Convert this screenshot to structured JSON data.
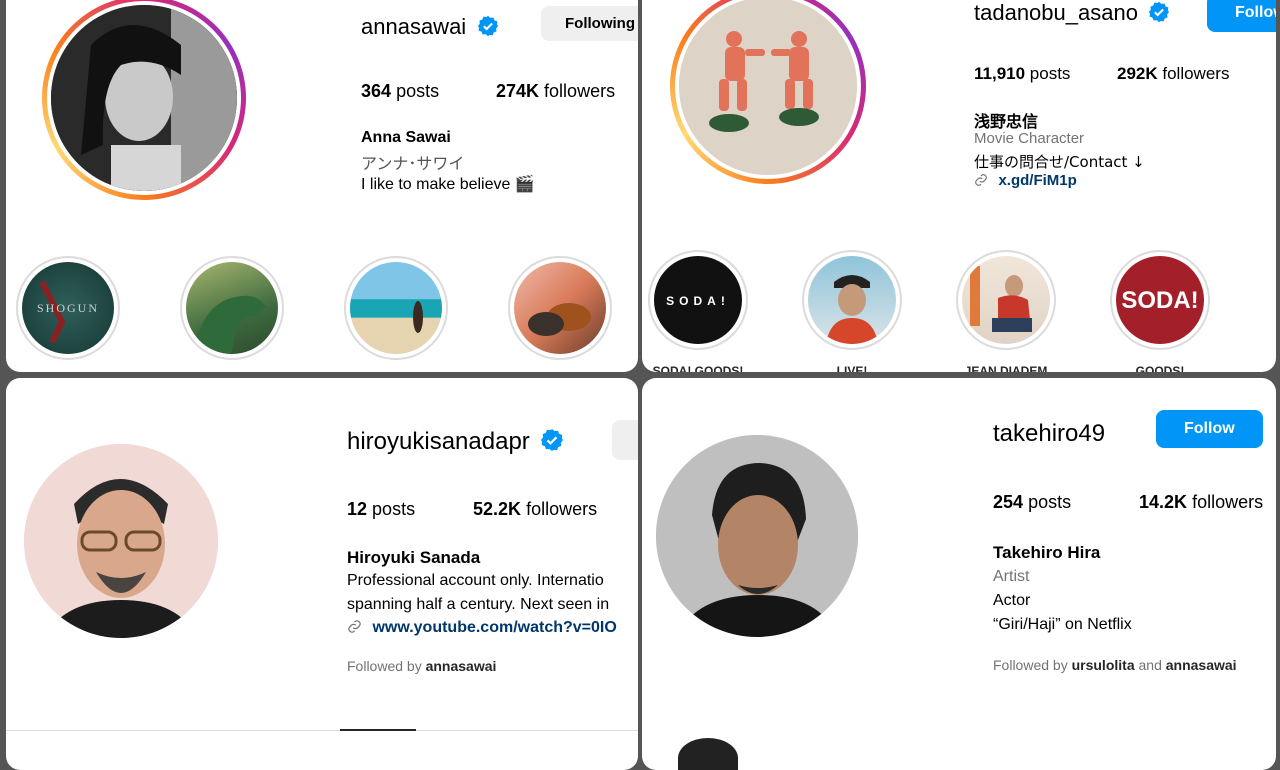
{
  "profiles": [
    {
      "username": "annasawai",
      "button": "Following",
      "posts_count": "364",
      "posts_label": "posts",
      "followers_count": "274K",
      "followers_label": "followers",
      "full_name": "Anna Sawai",
      "bio_lines": [
        "アンナ･サワイ",
        "I like to make believe 🎬"
      ],
      "highlights": [
        {
          "label": "",
          "art": "shogun"
        },
        {
          "label": "",
          "art": "godzilla"
        },
        {
          "label": "",
          "art": "beach"
        },
        {
          "label": "",
          "art": "dogs"
        }
      ]
    },
    {
      "username": "tadanobu_asano",
      "button": "Follow",
      "posts_count": "11,910",
      "posts_label": "posts",
      "followers_count": "292K",
      "followers_label": "followers",
      "full_name": "浅野忠信",
      "category": "Movie Character",
      "bio_lines": [
        "仕事の問合せ/Contact ↓"
      ],
      "link": "x.gd/FiM1p",
      "highlights": [
        {
          "label": "SODA! GOODS!",
          "art": "soda-black"
        },
        {
          "label": "LIVE!",
          "art": "man-cap"
        },
        {
          "label": "JEAN DIADEM",
          "art": "man-chair"
        },
        {
          "label": "GOODS!",
          "art": "soda-red"
        }
      ]
    },
    {
      "username": "hiroyukisanadapr",
      "posts_count": "12",
      "posts_label": "posts",
      "followers_count": "52.2K",
      "followers_label": "followers",
      "full_name": "Hiroyuki Sanada",
      "bio_lines": [
        "Professional account only. Internatio",
        "spanning half a century. Next seen in"
      ],
      "link": "www.youtube.com/watch?v=0IO",
      "followed_by_prefix": "Followed by",
      "followed_by_user1": "annasawai"
    },
    {
      "username": "takehiro49",
      "button": "Follow",
      "posts_count": "254",
      "posts_label": "posts",
      "followers_count": "14.2K",
      "followers_label": "followers",
      "full_name": "Takehiro Hira",
      "category": "Artist",
      "bio_lines": [
        "Actor",
        "“Giri/Haji” on Netflix"
      ],
      "followed_by_prefix": "Followed by",
      "followed_by_user1": "ursulolita",
      "followed_by_and": "and",
      "followed_by_user2": "annasawai"
    }
  ],
  "colors": {
    "follow_blue": "#0095f6",
    "verified_blue": "#0095f6",
    "link_color": "#00376b",
    "muted": "#737373"
  }
}
